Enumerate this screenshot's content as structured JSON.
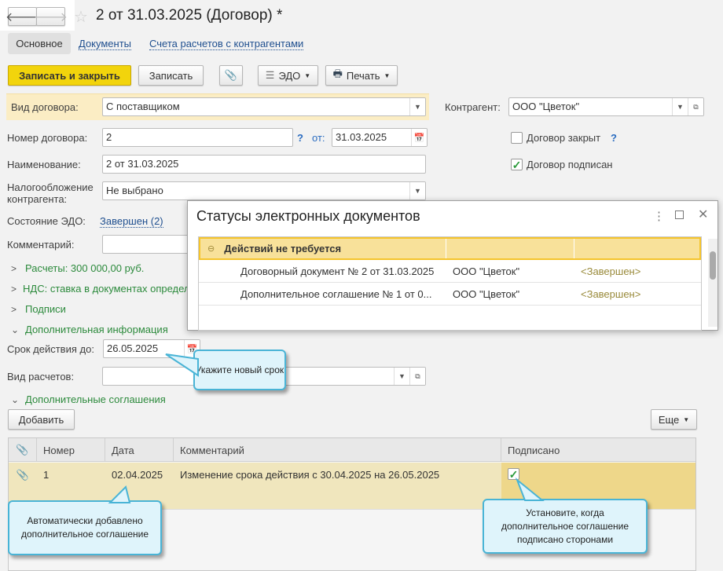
{
  "header": {
    "title": "2 от 31.03.2025 (Договор) *",
    "back_icon": "arrow-left",
    "forward_icon": "arrow-right",
    "favorite_icon": "star"
  },
  "tabs": [
    {
      "label": "Основное",
      "active": true
    },
    {
      "label": "Документы"
    },
    {
      "label": "Счета расчетов с контрагентами"
    }
  ],
  "toolbar": {
    "save_close": "Записать и закрыть",
    "save": "Записать",
    "attach_icon": "paperclip",
    "edo": "ЭДО",
    "print": "Печать"
  },
  "form": {
    "contract_type_label": "Вид договора:",
    "contract_type": "С поставщиком",
    "counterparty_label": "Контрагент:",
    "counterparty": "ООО \"Цветок\"",
    "number_label": "Номер договора:",
    "number": "2",
    "help": "?",
    "from_label": "от:",
    "date": "31.03.2025",
    "closed_label": "Договор закрыт",
    "closed": false,
    "name_label": "Наименование:",
    "name": "2 от 31.03.2025",
    "signed_label": "Договор подписан",
    "signed": true,
    "tax_label_1": "Налогообложение",
    "tax_label_2": "контрагента:",
    "tax": "Не выбрано",
    "edo_state_label": "Состояние ЭДО:",
    "edo_state": "Завершен (2)",
    "comment_label": "Комментарий:",
    "comment": "",
    "groups": {
      "payments": "Расчеты: 300 000,00 руб.",
      "vat": "НДС: ставка в документах определяется",
      "signatures": "Подписи",
      "extra": "Дополнительная информация",
      "agreements": "Дополнительные соглашения"
    },
    "valid_until_label": "Срок действия до:",
    "valid_until": "26.05.2025",
    "payment_type_label": "Вид расчетов:",
    "payment_type": ""
  },
  "agreements": {
    "add": "Добавить",
    "more": "Еще",
    "columns": [
      "Номер",
      "Дата",
      "Комментарий",
      "Подписано"
    ],
    "rows": [
      {
        "number": "1",
        "date": "02.04.2025",
        "comment": "Изменение срока действия с 30.04.2025 на 26.05.2025",
        "signed": true
      }
    ]
  },
  "popup": {
    "title": "Статусы электронных документов",
    "group": "Действий не требуется",
    "rows": [
      {
        "doc": "Договорный документ № 2 от 31.03.2025",
        "org": "ООО \"Цветок\"",
        "status": "<Завершен>"
      },
      {
        "doc": "Дополнительное соглашение № 1 от 0...",
        "org": "ООО \"Цветок\"",
        "status": "<Завершен>"
      }
    ]
  },
  "callouts": {
    "new_term": "Укажите новый срок",
    "auto_added": "Автоматически добавлено дополнительное соглашение",
    "set_signed": "Установите, когда дополнительное соглашение подписано сторонами"
  },
  "colors": {
    "primary_button": "#f2d40c",
    "group_text": "#2c8a3c",
    "highlight_row": "#f0e6bd",
    "callout": "#dff4fb"
  }
}
